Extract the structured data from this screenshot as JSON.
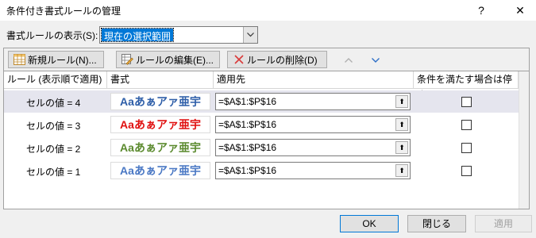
{
  "window": {
    "title": "条件付き書式ルールの管理",
    "help_glyph": "?",
    "close_glyph": "✕"
  },
  "scope": {
    "label": "書式ルールの表示(S):",
    "value": "現在の選択範囲"
  },
  "toolbar": {
    "new_rule": "新規ルール(N)...",
    "edit_rule": "ルールの編集(E)...",
    "delete_rule": "ルールの削除(D)",
    "move_up_glyph": "︿",
    "move_down_glyph": "﹀"
  },
  "columns": {
    "rule": "ルール (表示順で適用)",
    "format": "書式",
    "applies_to": "適用先",
    "stop_if_true": "条件を満たす場合は停止"
  },
  "rules": [
    {
      "name": "セルの値 = 4",
      "preview": "Aaあぁアァ亜宇",
      "preview_color": "#2e5ea8",
      "applies_to": "=$A$1:$P$16",
      "stop_if_true": false,
      "selected": true
    },
    {
      "name": "セルの値 = 3",
      "preview": "Aaあぁアァ亜宇",
      "preview_color": "#e01010",
      "applies_to": "=$A$1:$P$16",
      "stop_if_true": false,
      "selected": false
    },
    {
      "name": "セルの値 = 2",
      "preview": "Aaあぁアァ亜宇",
      "preview_color": "#5b8a2e",
      "applies_to": "=$A$1:$P$16",
      "stop_if_true": false,
      "selected": false
    },
    {
      "name": "セルの値 = 1",
      "preview": "Aaあぁアァ亜宇",
      "preview_color": "#4a78c4",
      "applies_to": "=$A$1:$P$16",
      "stop_if_true": false,
      "selected": false
    }
  ],
  "range_button_glyph": "⬆",
  "buttons": {
    "ok": "OK",
    "close": "閉じる",
    "apply": "適用"
  }
}
